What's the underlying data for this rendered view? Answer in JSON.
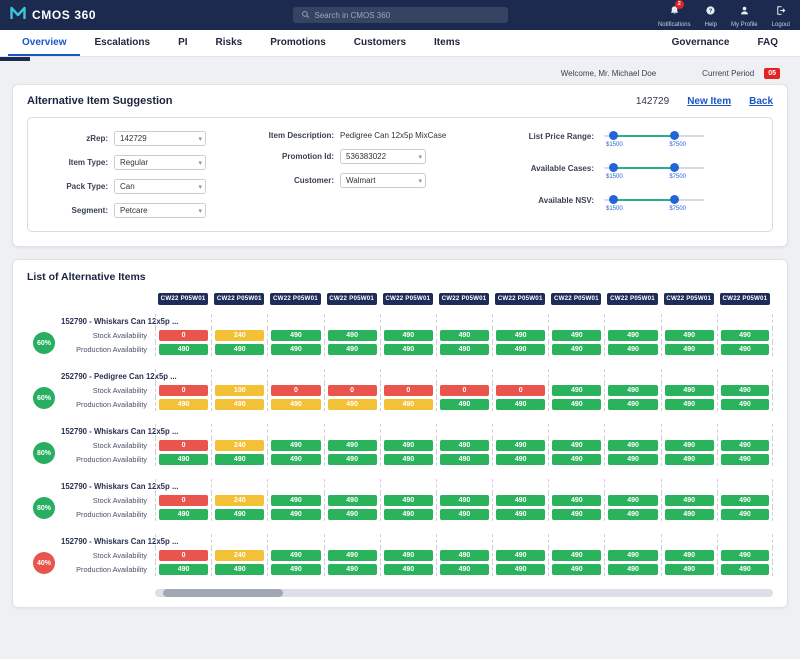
{
  "topbar": {
    "app_name": "CMOS 360",
    "search_placeholder": "Search in CMOS 360",
    "actions": [
      {
        "label": "Notifications",
        "badge": "2"
      },
      {
        "label": "Help"
      },
      {
        "label": "My Profile"
      },
      {
        "label": "Logout"
      }
    ]
  },
  "nav": {
    "tabs": [
      {
        "label": "Overview",
        "active": true
      },
      {
        "label": "Escalations"
      },
      {
        "label": "PI"
      },
      {
        "label": "Risks"
      },
      {
        "label": "Promotions"
      },
      {
        "label": "Customers"
      },
      {
        "label": "Items"
      }
    ],
    "right_tabs": [
      {
        "label": "Governance"
      },
      {
        "label": "FAQ"
      }
    ]
  },
  "subheader": {
    "welcome": "Welcome, Mr. Michael Doe",
    "current_period_label": "Current Period",
    "current_period_value": "05"
  },
  "suggestion_card": {
    "title": "Alternative Item Suggestion",
    "item_code": "142729",
    "new_item_label": "New Item",
    "back_label": "Back",
    "fields": {
      "zrep": {
        "label": "zRep:",
        "value": "142729"
      },
      "item_type": {
        "label": "Item Type:",
        "value": "Regular"
      },
      "pack_type": {
        "label": "Pack Type:",
        "value": "Can"
      },
      "segment": {
        "label": "Segment:",
        "value": "Petcare"
      },
      "item_description": {
        "label": "Item Description:",
        "value": "Pedigree Can 12x5p MixCase"
      },
      "promotion_id": {
        "label": "Promotion Id:",
        "value": "536383022"
      },
      "customer": {
        "label": "Customer:",
        "value": "Walmart"
      }
    },
    "sliders": [
      {
        "label": "List Price Range:",
        "min": "$1500",
        "max": "$7500"
      },
      {
        "label": "Available Cases:",
        "min": "$1500",
        "max": "$7500"
      },
      {
        "label": "Available NSV:",
        "min": "$1500",
        "max": "$7500"
      }
    ]
  },
  "list_card": {
    "title": "List of Alternative Items",
    "column_header": "CW22 P05W01",
    "column_count": 11,
    "row_labels": {
      "stock": "Stock Availability",
      "production": "Production Availability"
    },
    "groups": [
      {
        "item": "152790 - Whiskars Can 12x5p ...",
        "match": "60%",
        "match_color": "green",
        "stock": [
          {
            "v": "0",
            "c": "red"
          },
          {
            "v": "240",
            "c": "yellow"
          },
          {
            "v": "490",
            "c": "green"
          },
          {
            "v": "490",
            "c": "green"
          },
          {
            "v": "490",
            "c": "green"
          },
          {
            "v": "490",
            "c": "green"
          },
          {
            "v": "490",
            "c": "green"
          },
          {
            "v": "490",
            "c": "green"
          },
          {
            "v": "490",
            "c": "green"
          },
          {
            "v": "490",
            "c": "green"
          },
          {
            "v": "490",
            "c": "green"
          }
        ],
        "production": [
          {
            "v": "490",
            "c": "green"
          },
          {
            "v": "490",
            "c": "green"
          },
          {
            "v": "490",
            "c": "green"
          },
          {
            "v": "490",
            "c": "green"
          },
          {
            "v": "490",
            "c": "green"
          },
          {
            "v": "490",
            "c": "green"
          },
          {
            "v": "490",
            "c": "green"
          },
          {
            "v": "490",
            "c": "green"
          },
          {
            "v": "490",
            "c": "green"
          },
          {
            "v": "490",
            "c": "green"
          },
          {
            "v": "490",
            "c": "green"
          }
        ]
      },
      {
        "item": "252790 - Pedigree Can 12x5p ...",
        "match": "60%",
        "match_color": "green",
        "stock": [
          {
            "v": "0",
            "c": "red"
          },
          {
            "v": "100",
            "c": "yellow"
          },
          {
            "v": "0",
            "c": "red"
          },
          {
            "v": "0",
            "c": "red"
          },
          {
            "v": "0",
            "c": "red"
          },
          {
            "v": "0",
            "c": "red"
          },
          {
            "v": "0",
            "c": "red"
          },
          {
            "v": "490",
            "c": "green"
          },
          {
            "v": "490",
            "c": "green"
          },
          {
            "v": "490",
            "c": "green"
          },
          {
            "v": "490",
            "c": "green"
          }
        ],
        "production": [
          {
            "v": "490",
            "c": "yellow"
          },
          {
            "v": "490",
            "c": "yellow"
          },
          {
            "v": "490",
            "c": "yellow"
          },
          {
            "v": "490",
            "c": "yellow"
          },
          {
            "v": "490",
            "c": "yellow"
          },
          {
            "v": "490",
            "c": "green"
          },
          {
            "v": "490",
            "c": "green"
          },
          {
            "v": "490",
            "c": "green"
          },
          {
            "v": "490",
            "c": "green"
          },
          {
            "v": "490",
            "c": "green"
          },
          {
            "v": "490",
            "c": "green"
          }
        ]
      },
      {
        "item": "152790 - Whiskars Can 12x5p ...",
        "match": "80%",
        "match_color": "green",
        "stock": [
          {
            "v": "0",
            "c": "red"
          },
          {
            "v": "240",
            "c": "yellow"
          },
          {
            "v": "490",
            "c": "green"
          },
          {
            "v": "490",
            "c": "green"
          },
          {
            "v": "490",
            "c": "green"
          },
          {
            "v": "490",
            "c": "green"
          },
          {
            "v": "490",
            "c": "green"
          },
          {
            "v": "490",
            "c": "green"
          },
          {
            "v": "490",
            "c": "green"
          },
          {
            "v": "490",
            "c": "green"
          },
          {
            "v": "490",
            "c": "green"
          }
        ],
        "production": [
          {
            "v": "490",
            "c": "green"
          },
          {
            "v": "490",
            "c": "green"
          },
          {
            "v": "490",
            "c": "green"
          },
          {
            "v": "490",
            "c": "green"
          },
          {
            "v": "490",
            "c": "green"
          },
          {
            "v": "490",
            "c": "green"
          },
          {
            "v": "490",
            "c": "green"
          },
          {
            "v": "490",
            "c": "green"
          },
          {
            "v": "490",
            "c": "green"
          },
          {
            "v": "490",
            "c": "green"
          },
          {
            "v": "490",
            "c": "green"
          }
        ]
      },
      {
        "item": "152790 - Whiskars Can 12x5p ...",
        "match": "80%",
        "match_color": "green",
        "stock": [
          {
            "v": "0",
            "c": "red"
          },
          {
            "v": "240",
            "c": "yellow"
          },
          {
            "v": "490",
            "c": "green"
          },
          {
            "v": "490",
            "c": "green"
          },
          {
            "v": "490",
            "c": "green"
          },
          {
            "v": "490",
            "c": "green"
          },
          {
            "v": "490",
            "c": "green"
          },
          {
            "v": "490",
            "c": "green"
          },
          {
            "v": "490",
            "c": "green"
          },
          {
            "v": "490",
            "c": "green"
          },
          {
            "v": "490",
            "c": "green"
          }
        ],
        "production": [
          {
            "v": "490",
            "c": "green"
          },
          {
            "v": "490",
            "c": "green"
          },
          {
            "v": "490",
            "c": "green"
          },
          {
            "v": "490",
            "c": "green"
          },
          {
            "v": "490",
            "c": "green"
          },
          {
            "v": "490",
            "c": "green"
          },
          {
            "v": "490",
            "c": "green"
          },
          {
            "v": "490",
            "c": "green"
          },
          {
            "v": "490",
            "c": "green"
          },
          {
            "v": "490",
            "c": "green"
          },
          {
            "v": "490",
            "c": "green"
          }
        ]
      },
      {
        "item": "152790 - Whiskars Can 12x5p ...",
        "match": "40%",
        "match_color": "red",
        "stock": [
          {
            "v": "0",
            "c": "red"
          },
          {
            "v": "240",
            "c": "yellow"
          },
          {
            "v": "490",
            "c": "green"
          },
          {
            "v": "490",
            "c": "green"
          },
          {
            "v": "490",
            "c": "green"
          },
          {
            "v": "490",
            "c": "green"
          },
          {
            "v": "490",
            "c": "green"
          },
          {
            "v": "490",
            "c": "green"
          },
          {
            "v": "490",
            "c": "green"
          },
          {
            "v": "490",
            "c": "green"
          },
          {
            "v": "490",
            "c": "green"
          }
        ],
        "production": [
          {
            "v": "490",
            "c": "green"
          },
          {
            "v": "490",
            "c": "green"
          },
          {
            "v": "490",
            "c": "green"
          },
          {
            "v": "490",
            "c": "green"
          },
          {
            "v": "490",
            "c": "green"
          },
          {
            "v": "490",
            "c": "green"
          },
          {
            "v": "490",
            "c": "green"
          },
          {
            "v": "490",
            "c": "green"
          },
          {
            "v": "490",
            "c": "green"
          },
          {
            "v": "490",
            "c": "green"
          },
          {
            "v": "490",
            "c": "green"
          }
        ]
      }
    ]
  },
  "colors": {
    "green": "#2bb25c",
    "yellow": "#f3c136",
    "red": "#e9544d",
    "badge_green": "#27ae60",
    "badge_red": "#e9544d",
    "accent_blue": "#1a56c5",
    "navy": "#1b2a4e"
  }
}
